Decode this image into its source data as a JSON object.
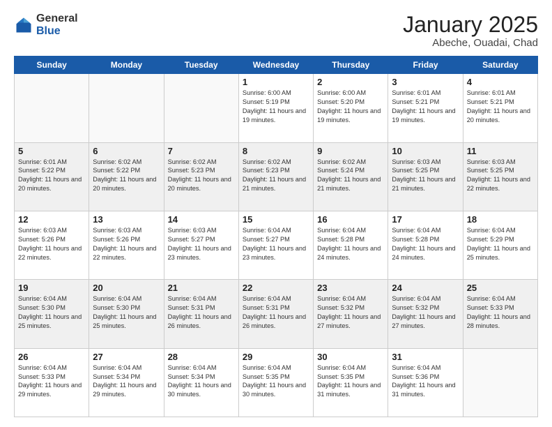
{
  "header": {
    "logo_general": "General",
    "logo_blue": "Blue",
    "month_title": "January 2025",
    "location": "Abeche, Ouadai, Chad"
  },
  "weekdays": [
    "Sunday",
    "Monday",
    "Tuesday",
    "Wednesday",
    "Thursday",
    "Friday",
    "Saturday"
  ],
  "weeks": [
    [
      {
        "day": "",
        "info": ""
      },
      {
        "day": "",
        "info": ""
      },
      {
        "day": "",
        "info": ""
      },
      {
        "day": "1",
        "info": "Sunrise: 6:00 AM\nSunset: 5:19 PM\nDaylight: 11 hours and 19 minutes."
      },
      {
        "day": "2",
        "info": "Sunrise: 6:00 AM\nSunset: 5:20 PM\nDaylight: 11 hours and 19 minutes."
      },
      {
        "day": "3",
        "info": "Sunrise: 6:01 AM\nSunset: 5:21 PM\nDaylight: 11 hours and 19 minutes."
      },
      {
        "day": "4",
        "info": "Sunrise: 6:01 AM\nSunset: 5:21 PM\nDaylight: 11 hours and 20 minutes."
      }
    ],
    [
      {
        "day": "5",
        "info": "Sunrise: 6:01 AM\nSunset: 5:22 PM\nDaylight: 11 hours and 20 minutes."
      },
      {
        "day": "6",
        "info": "Sunrise: 6:02 AM\nSunset: 5:22 PM\nDaylight: 11 hours and 20 minutes."
      },
      {
        "day": "7",
        "info": "Sunrise: 6:02 AM\nSunset: 5:23 PM\nDaylight: 11 hours and 20 minutes."
      },
      {
        "day": "8",
        "info": "Sunrise: 6:02 AM\nSunset: 5:23 PM\nDaylight: 11 hours and 21 minutes."
      },
      {
        "day": "9",
        "info": "Sunrise: 6:02 AM\nSunset: 5:24 PM\nDaylight: 11 hours and 21 minutes."
      },
      {
        "day": "10",
        "info": "Sunrise: 6:03 AM\nSunset: 5:25 PM\nDaylight: 11 hours and 21 minutes."
      },
      {
        "day": "11",
        "info": "Sunrise: 6:03 AM\nSunset: 5:25 PM\nDaylight: 11 hours and 22 minutes."
      }
    ],
    [
      {
        "day": "12",
        "info": "Sunrise: 6:03 AM\nSunset: 5:26 PM\nDaylight: 11 hours and 22 minutes."
      },
      {
        "day": "13",
        "info": "Sunrise: 6:03 AM\nSunset: 5:26 PM\nDaylight: 11 hours and 22 minutes."
      },
      {
        "day": "14",
        "info": "Sunrise: 6:03 AM\nSunset: 5:27 PM\nDaylight: 11 hours and 23 minutes."
      },
      {
        "day": "15",
        "info": "Sunrise: 6:04 AM\nSunset: 5:27 PM\nDaylight: 11 hours and 23 minutes."
      },
      {
        "day": "16",
        "info": "Sunrise: 6:04 AM\nSunset: 5:28 PM\nDaylight: 11 hours and 24 minutes."
      },
      {
        "day": "17",
        "info": "Sunrise: 6:04 AM\nSunset: 5:28 PM\nDaylight: 11 hours and 24 minutes."
      },
      {
        "day": "18",
        "info": "Sunrise: 6:04 AM\nSunset: 5:29 PM\nDaylight: 11 hours and 25 minutes."
      }
    ],
    [
      {
        "day": "19",
        "info": "Sunrise: 6:04 AM\nSunset: 5:30 PM\nDaylight: 11 hours and 25 minutes."
      },
      {
        "day": "20",
        "info": "Sunrise: 6:04 AM\nSunset: 5:30 PM\nDaylight: 11 hours and 25 minutes."
      },
      {
        "day": "21",
        "info": "Sunrise: 6:04 AM\nSunset: 5:31 PM\nDaylight: 11 hours and 26 minutes."
      },
      {
        "day": "22",
        "info": "Sunrise: 6:04 AM\nSunset: 5:31 PM\nDaylight: 11 hours and 26 minutes."
      },
      {
        "day": "23",
        "info": "Sunrise: 6:04 AM\nSunset: 5:32 PM\nDaylight: 11 hours and 27 minutes."
      },
      {
        "day": "24",
        "info": "Sunrise: 6:04 AM\nSunset: 5:32 PM\nDaylight: 11 hours and 27 minutes."
      },
      {
        "day": "25",
        "info": "Sunrise: 6:04 AM\nSunset: 5:33 PM\nDaylight: 11 hours and 28 minutes."
      }
    ],
    [
      {
        "day": "26",
        "info": "Sunrise: 6:04 AM\nSunset: 5:33 PM\nDaylight: 11 hours and 29 minutes."
      },
      {
        "day": "27",
        "info": "Sunrise: 6:04 AM\nSunset: 5:34 PM\nDaylight: 11 hours and 29 minutes."
      },
      {
        "day": "28",
        "info": "Sunrise: 6:04 AM\nSunset: 5:34 PM\nDaylight: 11 hours and 30 minutes."
      },
      {
        "day": "29",
        "info": "Sunrise: 6:04 AM\nSunset: 5:35 PM\nDaylight: 11 hours and 30 minutes."
      },
      {
        "day": "30",
        "info": "Sunrise: 6:04 AM\nSunset: 5:35 PM\nDaylight: 11 hours and 31 minutes."
      },
      {
        "day": "31",
        "info": "Sunrise: 6:04 AM\nSunset: 5:36 PM\nDaylight: 11 hours and 31 minutes."
      },
      {
        "day": "",
        "info": ""
      }
    ]
  ]
}
